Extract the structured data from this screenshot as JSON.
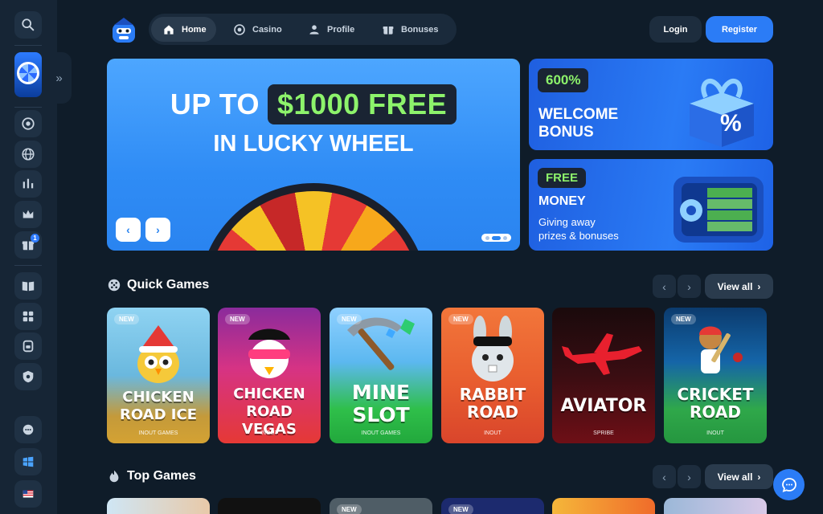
{
  "nav": {
    "home": "Home",
    "casino": "Casino",
    "profile": "Profile",
    "bonuses": "Bonuses"
  },
  "auth": {
    "login": "Login",
    "register": "Register"
  },
  "hero": {
    "line1_prefix": "UP TO",
    "amount": "$1000 FREE",
    "line2": "IN LUCKY WHEEL",
    "slide_count": 3,
    "active_slide": 2
  },
  "promos": [
    {
      "tag": "600%",
      "title_line1": "WELCOME",
      "title_line2": "BONUS",
      "desc_line1": "",
      "desc_line2": ""
    },
    {
      "tag": "FREE",
      "title_line1": "MONEY",
      "title_line2": "",
      "desc_line1": "Giving away",
      "desc_line2": "prizes & bonuses"
    }
  ],
  "sidebar": {
    "notification_count": "1",
    "icons": [
      "search-icon",
      "lucky-wheel-icon",
      "casino-chip-icon",
      "globe-icon",
      "stats-icon",
      "crown-icon",
      "gift-icon",
      "book-icon",
      "game-controller-icon",
      "package-icon",
      "shield-icon",
      "chat-icon",
      "windows-icon",
      "flag-us-icon"
    ]
  },
  "quick_games": {
    "title": "Quick Games",
    "view_all": "View all",
    "games": [
      {
        "title_l1": "CHICKEN",
        "title_l2": "ROAD ICE",
        "provider": "INOUT GAMES",
        "is_new": true,
        "badge": "NEW"
      },
      {
        "title_l1": "CHICKEN",
        "title_l2": "ROAD VEGAS",
        "provider": "INOUT",
        "is_new": true,
        "badge": "NEW"
      },
      {
        "title_l1": "MINE",
        "title_l2": "SLOT",
        "provider": "INOUT GAMES",
        "is_new": true,
        "badge": "NEW"
      },
      {
        "title_l1": "RABBIT",
        "title_l2": "ROAD",
        "provider": "INOUT",
        "is_new": true,
        "badge": "NEW"
      },
      {
        "title_l1": "AVIATOR",
        "title_l2": "",
        "provider": "SPRIBE",
        "is_new": false,
        "badge": ""
      },
      {
        "title_l1": "CRICKET",
        "title_l2": "ROAD",
        "provider": "INOUT",
        "is_new": true,
        "badge": "NEW"
      }
    ]
  },
  "top_games": {
    "title": "Top Games",
    "view_all": "View all",
    "badges": [
      "",
      "",
      "NEW",
      "NEW",
      "",
      ""
    ]
  },
  "colors": {
    "accent": "#2b7cf6",
    "background": "#0f1c29",
    "highlight_green": "#8df36b"
  }
}
